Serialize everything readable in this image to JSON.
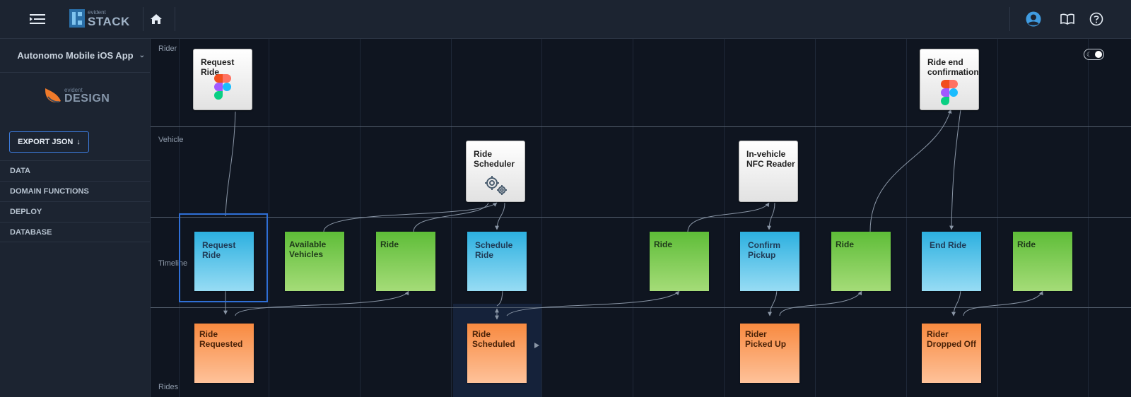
{
  "topbar": {
    "logo_small": "evident",
    "logo_big": "STACK",
    "icons": [
      "menu-icon",
      "home-icon",
      "user-icon",
      "book-icon",
      "help-icon"
    ]
  },
  "sidebar": {
    "project_name": "Autonomo Mobile iOS App",
    "design_logo_small": "evident",
    "design_logo_big": "DESIGN",
    "export_label": "EXPORT JSON",
    "nav": [
      "DATA",
      "DOMAIN FUNCTIONS",
      "DEPLOY",
      "DATABASE"
    ]
  },
  "lanes": {
    "rider": "Rider",
    "vehicle": "Vehicle",
    "timeline": "Timeline",
    "rides": "Rides"
  },
  "cards": {
    "request_ride_ui": "Request Ride",
    "ride_end_ui": "Ride end confirmation",
    "ride_scheduler": "Ride Scheduler",
    "nfc_reader": "In-vehicle NFC Reader",
    "timeline": {
      "request_ride": "Request Ride",
      "available_vehicles": "Available Vehicles",
      "ride_1": "Ride",
      "schedule_ride": "Schedule Ride",
      "ride_2": "Ride",
      "confirm_pickup": "Confirm Pickup",
      "ride_3": "Ride",
      "end_ride": "End Ride",
      "ride_4": "Ride"
    },
    "events": {
      "ride_requested": "Ride Requested",
      "ride_scheduled": "Ride Scheduled",
      "rider_picked_up": "Rider Picked Up",
      "rider_dropped_off": "Rider Dropped Off"
    }
  },
  "colors": {
    "command": "#2cb0e0",
    "read_model": "#5ebd38",
    "event": "#f88a40",
    "selection": "#2f6fd6"
  }
}
